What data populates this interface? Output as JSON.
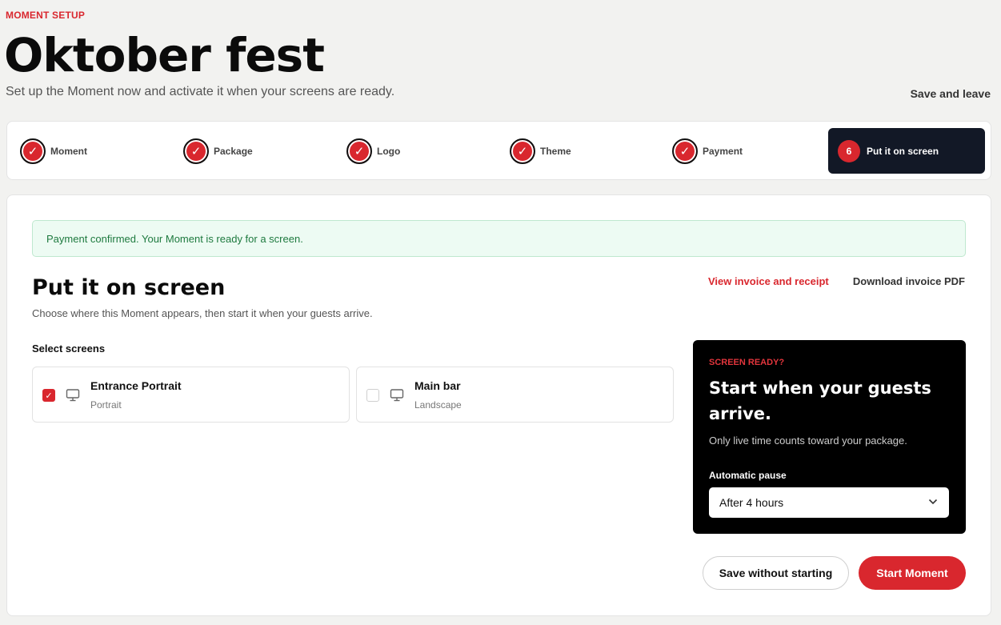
{
  "header": {
    "eyebrow": "MOMENT SETUP",
    "title": "Oktober fest",
    "subtitle": "Set up the Moment now and activate it when your screens are ready.",
    "save_leave": "Save and leave"
  },
  "stepper": {
    "steps": [
      {
        "label": "Moment",
        "state": "complete",
        "icon": "check-icon"
      },
      {
        "label": "Package",
        "state": "complete",
        "icon": "check-icon"
      },
      {
        "label": "Logo",
        "state": "complete",
        "icon": "check-icon"
      },
      {
        "label": "Theme",
        "state": "complete",
        "icon": "check-icon"
      },
      {
        "label": "Payment",
        "state": "complete",
        "icon": "check-icon"
      },
      {
        "label": "Put it on screen",
        "state": "active",
        "number": "6"
      }
    ]
  },
  "alert": {
    "text": "Payment confirmed. Your Moment is ready for a screen."
  },
  "section": {
    "title": "Put it on screen",
    "subtitle": "Choose where this Moment appears, then start it when your guests arrive.",
    "link_invoice": "View invoice and receipt",
    "link_pdf": "Download invoice PDF",
    "select_label": "Select screens"
  },
  "screens": [
    {
      "name": "Entrance Portrait",
      "orientation": "Portrait",
      "checked": true,
      "icon": "monitor-icon"
    },
    {
      "name": "Main bar",
      "orientation": "Landscape",
      "checked": false,
      "icon": "monitor-icon"
    }
  ],
  "ready_panel": {
    "eyebrow": "SCREEN READY?",
    "title": "Start when your guests arrive.",
    "subtitle": "Only live time counts toward your package.",
    "pause_label": "Automatic pause",
    "pause_value": "After 4 hours"
  },
  "actions": {
    "save_without_starting": "Save without starting",
    "start": "Start Moment"
  },
  "colors": {
    "accent": "#d9272e",
    "dark": "#121826",
    "success_bg": "#edfbf3",
    "success_text": "#1e7a3f"
  }
}
